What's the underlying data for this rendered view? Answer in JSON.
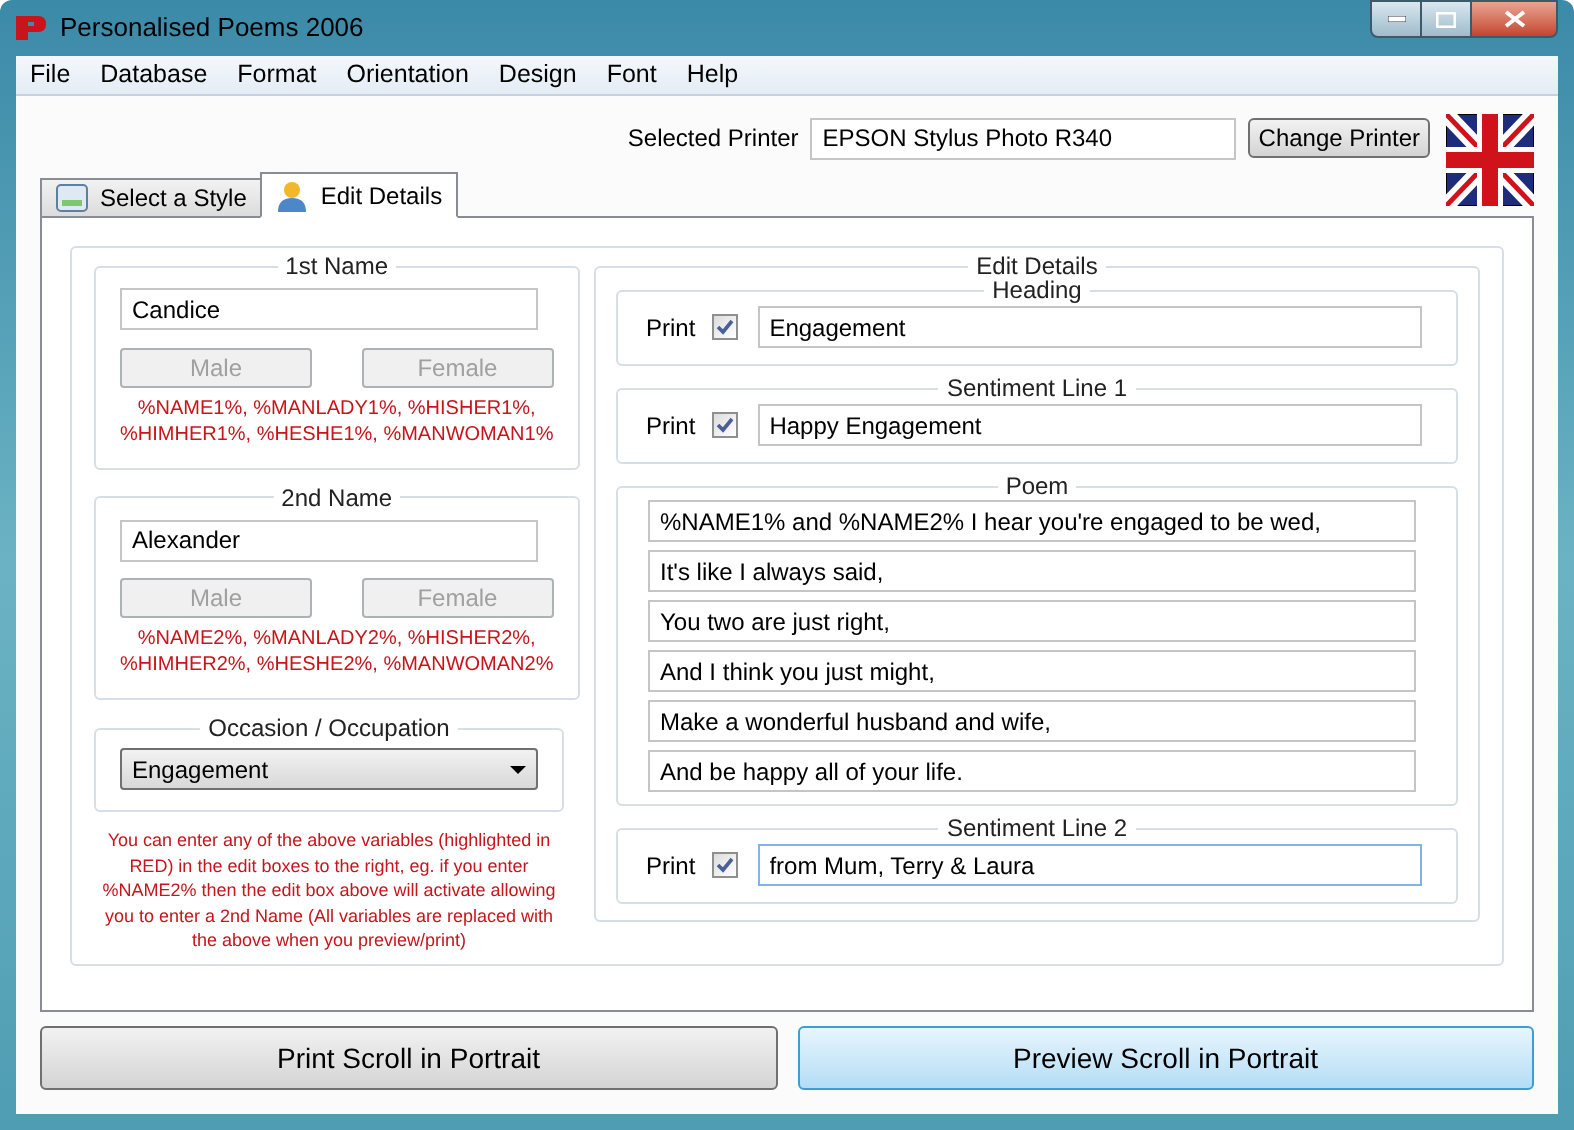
{
  "window": {
    "title": "Personalised Poems 2006"
  },
  "menu": [
    "File",
    "Database",
    "Format",
    "Orientation",
    "Design",
    "Font",
    "Help"
  ],
  "printer": {
    "label": "Selected Printer",
    "value": "EPSON Stylus Photo R340",
    "button": "Change Printer"
  },
  "tabs": [
    {
      "label": "Select a Style",
      "kind": "style",
      "selected": false
    },
    {
      "label": "Edit Details",
      "kind": "person",
      "selected": true
    }
  ],
  "names": [
    {
      "title": "1st Name",
      "value": "Candice",
      "buttons": [
        {
          "label": "Male",
          "disabled": true
        },
        {
          "label": "Female",
          "disabled": true
        }
      ],
      "variables": [
        "%NAME1%, %MANLADY1%, %HISHER1%,",
        "%HIMHER1%, %HESHE1%, %MANWOMAN1%"
      ]
    },
    {
      "title": "2nd Name",
      "value": "Alexander",
      "buttons": [
        {
          "label": "Male",
          "disabled": true
        },
        {
          "label": "Female",
          "disabled": true
        }
      ],
      "variables": [
        "%NAME2%, %MANLADY2%, %HISHER2%,",
        "%HIMHER2%, %HESHE2%, %MANWOMAN2%"
      ]
    }
  ],
  "occasion": {
    "title": "Occasion / Occupation",
    "value": "Engagement"
  },
  "note": "You can enter any of the above variables (highlighted in RED) in the edit boxes to the right, eg. if you enter %NAME2% then the edit box above will activate allowing you to enter a 2nd Name (All variables are replaced with the above when you preview/print)",
  "edit_details": {
    "title": "Edit Details",
    "heading": {
      "title": "Heading",
      "print_label": "Print",
      "checked": true,
      "value": "Engagement",
      "focused": false
    },
    "sentiment_1": {
      "title": "Sentiment Line 1",
      "print_label": "Print",
      "checked": true,
      "value": "Happy Engagement",
      "focused": false
    },
    "poem": {
      "title": "Poem",
      "lines": [
        "%NAME1% and %NAME2% I hear you're engaged to be wed,",
        "It's like I always said,",
        "You two are just right,",
        "And I think you just might,",
        "Make a wonderful husband and wife,",
        "And be happy all of your life."
      ]
    },
    "sentiment_2": {
      "title": "Sentiment Line 2",
      "print_label": "Print",
      "checked": true,
      "value": "from Mum, Terry & Laura",
      "focused": true
    }
  },
  "actions": [
    {
      "label": "Print Scroll in Portrait",
      "highlighted": false
    },
    {
      "label": "Preview Scroll in Portrait",
      "highlighted": true
    }
  ]
}
